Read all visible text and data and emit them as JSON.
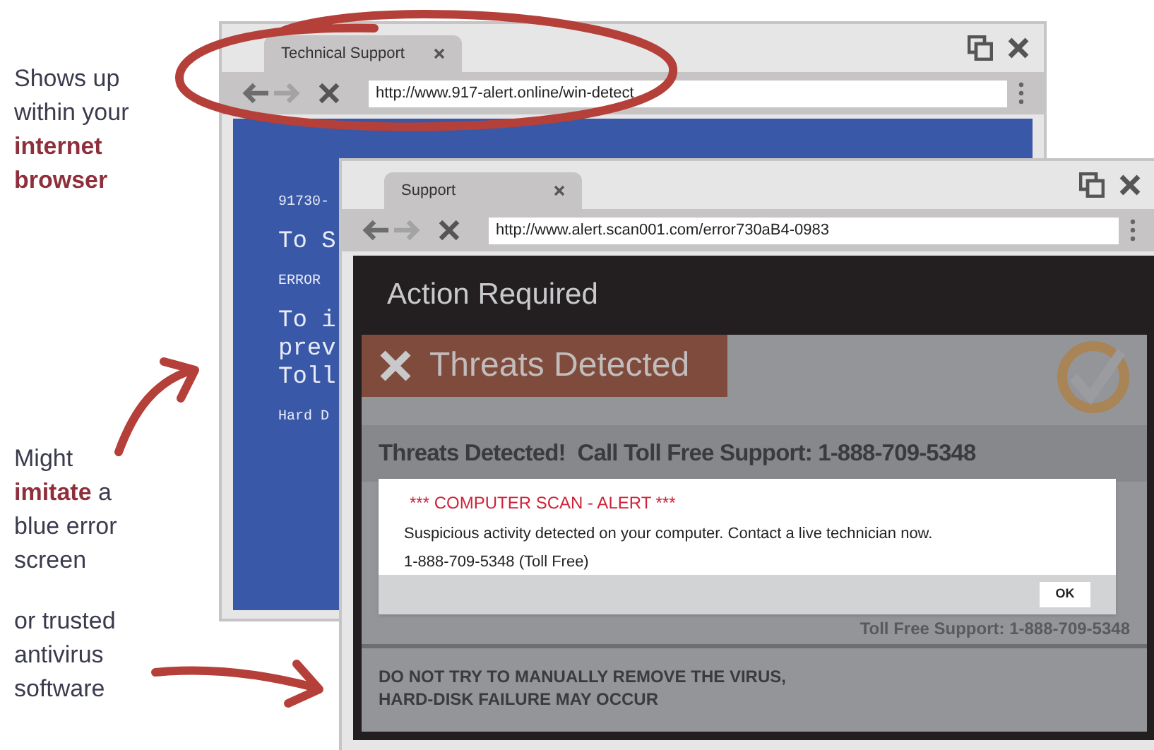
{
  "annotations": [
    {
      "text": "Shows up within your **internet browser**"
    },
    {
      "text": "Might **imitate** a blue error screen"
    },
    {
      "text": "or trusted antivirus software"
    }
  ],
  "windows": [
    {
      "kind": "blue_screen",
      "tab": "Technical Support",
      "url": "http://www.917-alert.online/win-detect",
      "paragraphs": [
        {
          "kind": "small",
          "lines": [
            "91730-"
          ]
        },
        {
          "kind": "large",
          "lines": [
            "To S"
          ]
        },
        {
          "kind": "small",
          "lines": [
            "ERROR"
          ]
        },
        {
          "kind": "large",
          "lines": [
            "To i",
            "prev",
            "Toll"
          ]
        },
        {
          "kind": "small",
          "lines": [
            "Hard D"
          ]
        }
      ]
    },
    {
      "kind": "antivirus",
      "tab": "Support",
      "url": "http://www.alert.scan001.com/error730aB4-0983",
      "header": "Action Required",
      "banner": "Threats Detected",
      "headline": "Threats Detected!  Call Toll Free Support: 1-888-709-5348",
      "support_line": "Toll Free Support: 1-888-709-5348",
      "warning": "DO NOT TRY TO MANUALLY REMOVE THE VIRUS,\nHARD-DISK FAILURE MAY OCCUR",
      "dialog": {
        "title": "*** COMPUTER SCAN - ALERT ***",
        "message": "Suspicious activity detected on your computer. Contact a live technician now.",
        "phone": "1-888-709-5348 (Toll Free)",
        "button": "OK"
      }
    }
  ]
}
